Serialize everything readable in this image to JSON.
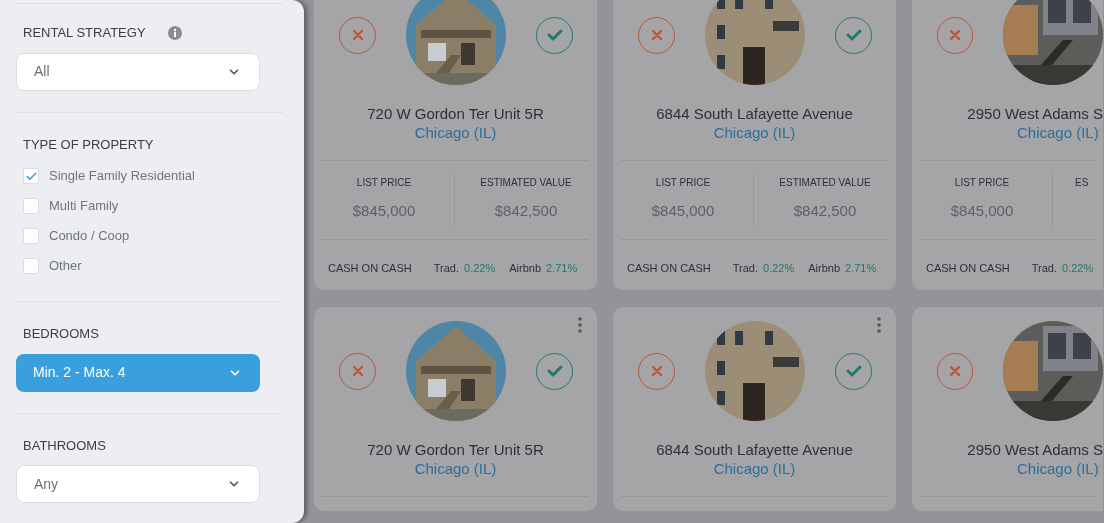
{
  "sidebar": {
    "sections": [
      {
        "kind": "select",
        "title": "RENTAL STRATEGY",
        "info": true,
        "value": "All",
        "highlighted": false
      },
      {
        "kind": "checklist",
        "title": "TYPE OF PROPERTY",
        "options": [
          {
            "label": "Single Family Residential",
            "checked": true
          },
          {
            "label": "Multi Family",
            "checked": false
          },
          {
            "label": "Condo / Coop",
            "checked": false
          },
          {
            "label": "Other",
            "checked": false
          }
        ]
      },
      {
        "kind": "select",
        "title": "BEDROOMS",
        "info": false,
        "value": "Min. 2 - Max. 4",
        "highlighted": true
      },
      {
        "kind": "select",
        "title": "BATHROOMS",
        "info": false,
        "value": "Any",
        "highlighted": false
      }
    ]
  },
  "listing_rows": [
    {
      "cards": [
        {
          "address": "720 W Gordon Ter Unit 5R",
          "city": "Chicago (IL)",
          "list_price_label": "LIST PRICE",
          "list_price": "$845,000",
          "estimated_value_label": "ESTIMATED VALUE",
          "estimated_value": "$842,500",
          "coc_label": "CASH ON CASH",
          "trad_label": "Trad.",
          "trad_value": "0.22%",
          "airbnb_label": "Airbnb",
          "airbnb_value": "2.71%"
        },
        {
          "address": "6844 South Lafayette Avenue",
          "city": "Chicago (IL)",
          "list_price_label": "LIST PRICE",
          "list_price": "$845,000",
          "estimated_value_label": "ESTIMATED VALUE",
          "estimated_value": "$842,500",
          "coc_label": "CASH ON CASH",
          "trad_label": "Trad.",
          "trad_value": "0.22%",
          "airbnb_label": "Airbnb",
          "airbnb_value": "2.71%"
        },
        {
          "address": "2950 West Adams S",
          "city": "Chicago (IL)",
          "list_price_label": "LIST PRICE",
          "list_price": "$845,000",
          "estimated_value_label": "ES",
          "coc_label": "CASH ON CASH",
          "trad_label": "Trad.",
          "trad_value": "0.22%"
        }
      ]
    },
    {
      "cards": [
        {
          "menu": true,
          "address": "720 W Gordon Ter Unit 5R",
          "city": "Chicago (IL)"
        },
        {
          "menu": true,
          "address": "6844 South Lafayette Avenue",
          "city": "Chicago (IL)"
        },
        {
          "address": "2950 West Adams S",
          "city": "Chicago (IL)"
        }
      ]
    }
  ]
}
